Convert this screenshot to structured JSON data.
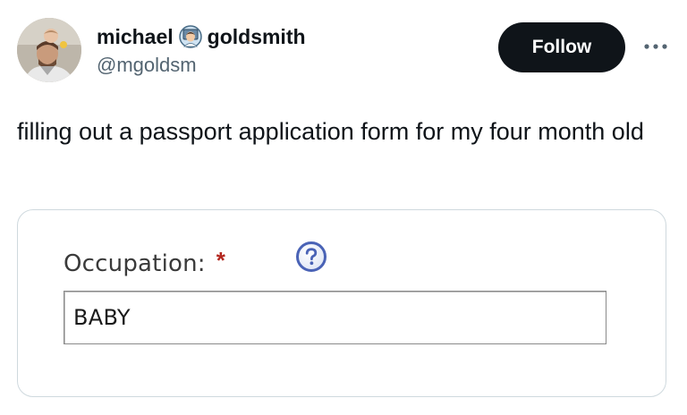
{
  "author": {
    "first_name": "michael",
    "last_name": "goldsmith",
    "name_icon": "man-technologist-emoji",
    "handle": "@mgoldsm",
    "avatar": "profile-photo"
  },
  "actions": {
    "follow_label": "Follow",
    "more_icon": "more-icon"
  },
  "tweet": {
    "text": "filling out a passport application form for my four month old"
  },
  "form": {
    "field_label": "Occupation:",
    "required_marker": "*",
    "help_icon": "help-icon",
    "field_value": "BABY"
  },
  "colors": {
    "follow_bg": "#0f1419",
    "handle_text": "#536471",
    "required_star": "#b3261e",
    "help_icon_blue": "#4a63b6",
    "card_border": "#cfd9de"
  }
}
